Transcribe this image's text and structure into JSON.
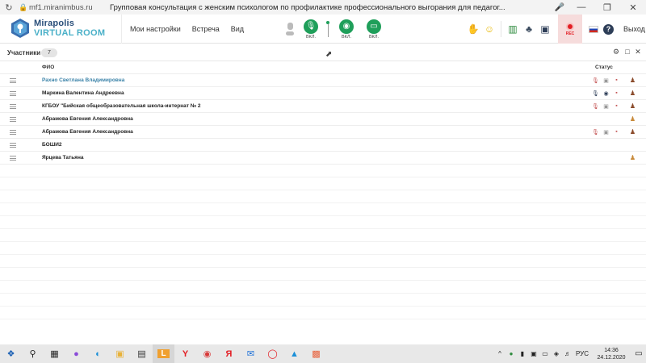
{
  "browser": {
    "url": "mf1.miranimbus.ru",
    "tab_title": "Групповая консультация с женским психологом по профилактике профессионального выгорания для педагог..."
  },
  "app": {
    "brand_line1": "Mirapolis",
    "brand_line2": "VIRTUAL ROOM",
    "menu": [
      "Мои настройки",
      "Встреча",
      "Вид"
    ],
    "media": {
      "mic_caption": "ВКЛ.",
      "camera_caption": "ВКЛ.",
      "screen_caption": "ВКЛ."
    },
    "rec_caption": "REC",
    "logout": "Выход",
    "colors": {
      "accent_green": "#1f9f5a",
      "brand_blue": "#2a4f7a",
      "brand_cyan": "#4ab0c8",
      "rec_red": "#e31e24"
    }
  },
  "participants": {
    "title": "Участники",
    "count": "7",
    "col_name": "ФИО",
    "col_status": "Статус",
    "rows": [
      {
        "name": "Рахно Светлана  Владимировна"
      },
      {
        "name": "Маркина Валентина  Андреевна"
      },
      {
        "name": "КГБОУ \"Бийская общеобразовательная школа-интернат № 2"
      },
      {
        "name": "Абрамова  Евгения  Александровна"
      },
      {
        "name": "Абрамова  Евгения  Александровна"
      },
      {
        "name": "БОШИ2"
      },
      {
        "name": "Ярцева Татьяна"
      }
    ]
  },
  "taskbar": {
    "language": "РУС",
    "time": "14:36",
    "date": "24.12.2020"
  }
}
